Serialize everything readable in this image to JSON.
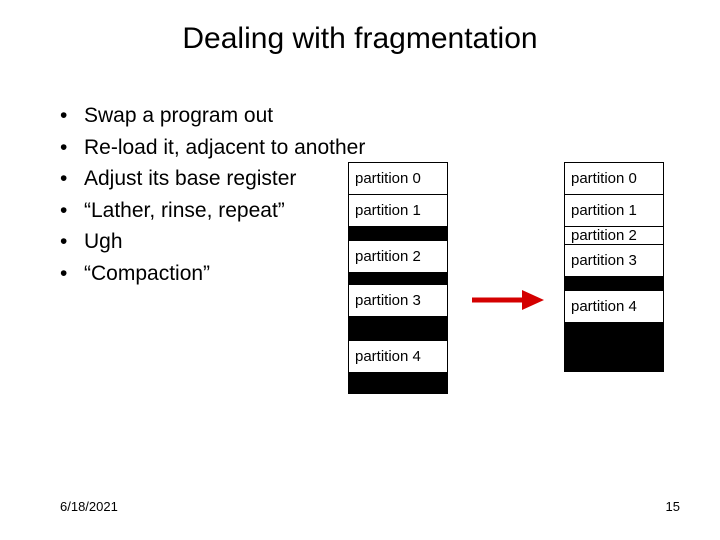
{
  "title": "Dealing with fragmentation",
  "bullets": [
    "Swap a program out",
    "Re-load it, adjacent to another",
    "Adjust its base register",
    "“Lather, rinse, repeat”",
    "Ugh",
    "“Compaction”"
  ],
  "partition_labels": {
    "p0": "partition 0",
    "p1": "partition 1",
    "p2": "partition 2",
    "p3": "partition 3",
    "p4": "partition 4"
  },
  "arrow_color": "#d40000",
  "footer": {
    "date": "6/18/2021",
    "page": "15"
  }
}
